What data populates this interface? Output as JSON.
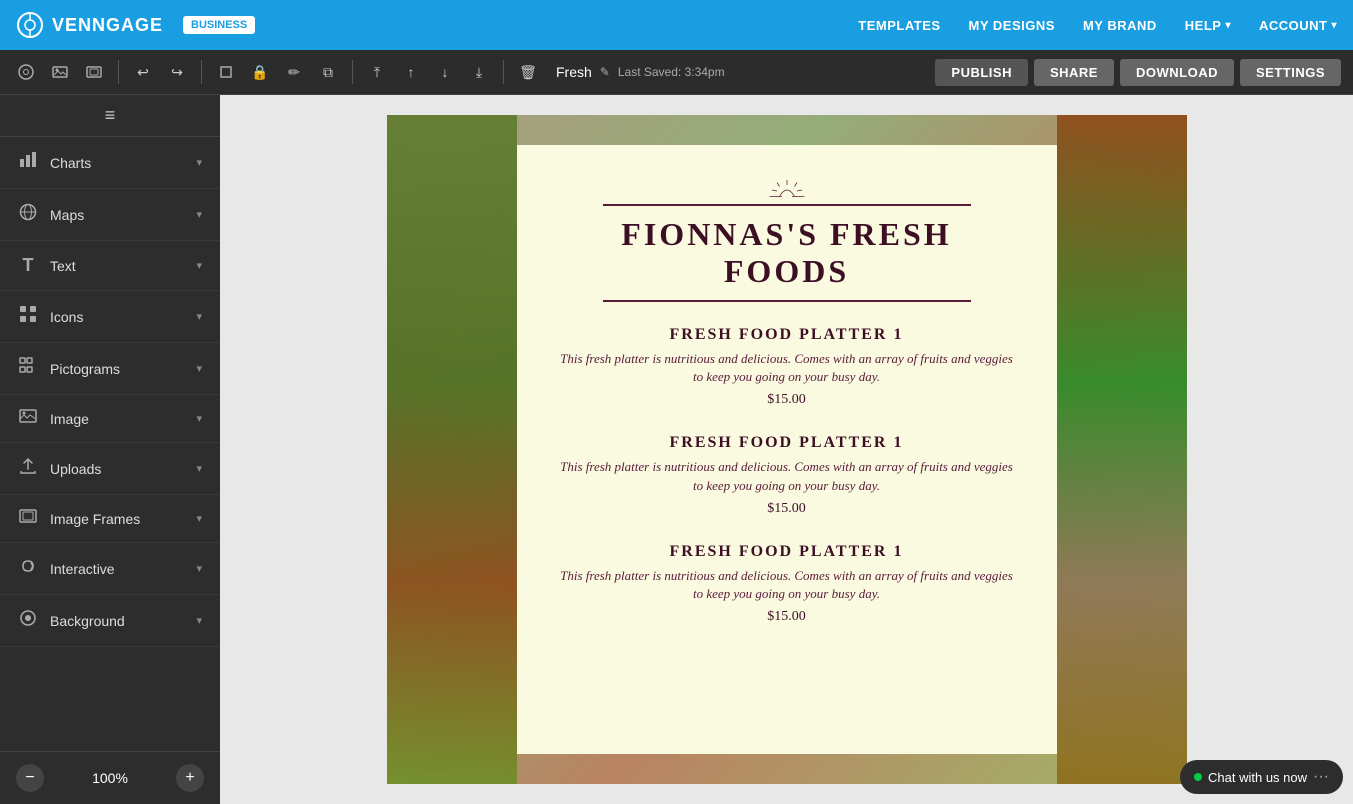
{
  "nav": {
    "logo_text": "VENNGAGE",
    "business_badge": "BUSINESS",
    "links": [
      {
        "label": "TEMPLATES",
        "has_caret": false
      },
      {
        "label": "MY DESIGNS",
        "has_caret": false
      },
      {
        "label": "MY BRAND",
        "has_caret": false
      },
      {
        "label": "HELP",
        "has_caret": true
      },
      {
        "label": "ACCOUNT",
        "has_caret": true
      }
    ]
  },
  "toolbar": {
    "doc_name": "Fresh",
    "last_saved": "Last Saved: 3:34pm",
    "buttons": {
      "publish": "PUBLISH",
      "share": "SHARE",
      "download": "DOWNLOAD",
      "settings": "SETTINGS"
    }
  },
  "sidebar": {
    "items": [
      {
        "label": "Charts",
        "icon": "bar-chart"
      },
      {
        "label": "Maps",
        "icon": "globe"
      },
      {
        "label": "Text",
        "icon": "text-t"
      },
      {
        "label": "Icons",
        "icon": "icons"
      },
      {
        "label": "Pictograms",
        "icon": "pictogram"
      },
      {
        "label": "Image",
        "icon": "image"
      },
      {
        "label": "Uploads",
        "icon": "upload"
      },
      {
        "label": "Image Frames",
        "icon": "frame"
      },
      {
        "label": "Interactive",
        "icon": "interactive"
      },
      {
        "label": "Background",
        "icon": "background"
      }
    ],
    "zoom_level": "100%"
  },
  "canvas": {
    "title": "FIONNAS'S FRESH FOODS",
    "menu_title": "FIONNAS'S FRESH FOODS",
    "menu_items": [
      {
        "name": "FRESH FOOD PLATTER 1",
        "description": "This fresh platter is nutritious and delicious. Comes with an array of fruits and veggies to keep you going on your busy day.",
        "price": "$15.00"
      },
      {
        "name": "FRESH FOOD PLATTER 1",
        "description": "This fresh platter is nutritious and delicious. Comes with an array of fruits and veggies to keep you going on your busy day.",
        "price": "$15.00"
      },
      {
        "name": "FRESH FOOD PLATTER 1",
        "description": "This fresh platter is nutritious and delicious. Comes with an array of fruits and veggies to keep you going on your busy day.",
        "price": "$15.00"
      }
    ]
  },
  "chat": {
    "label": "Chat with us now"
  },
  "icons": {
    "bar_chart": "▦",
    "globe": "⊕",
    "text": "T",
    "icons_grid": "⊞",
    "pictograms": "⊟",
    "image": "▭",
    "upload": "↑",
    "frame": "▢",
    "interactive": "⟳",
    "background": "◉",
    "chevron_down": "›",
    "hamburger": "≡",
    "minus": "−",
    "plus": "+"
  }
}
